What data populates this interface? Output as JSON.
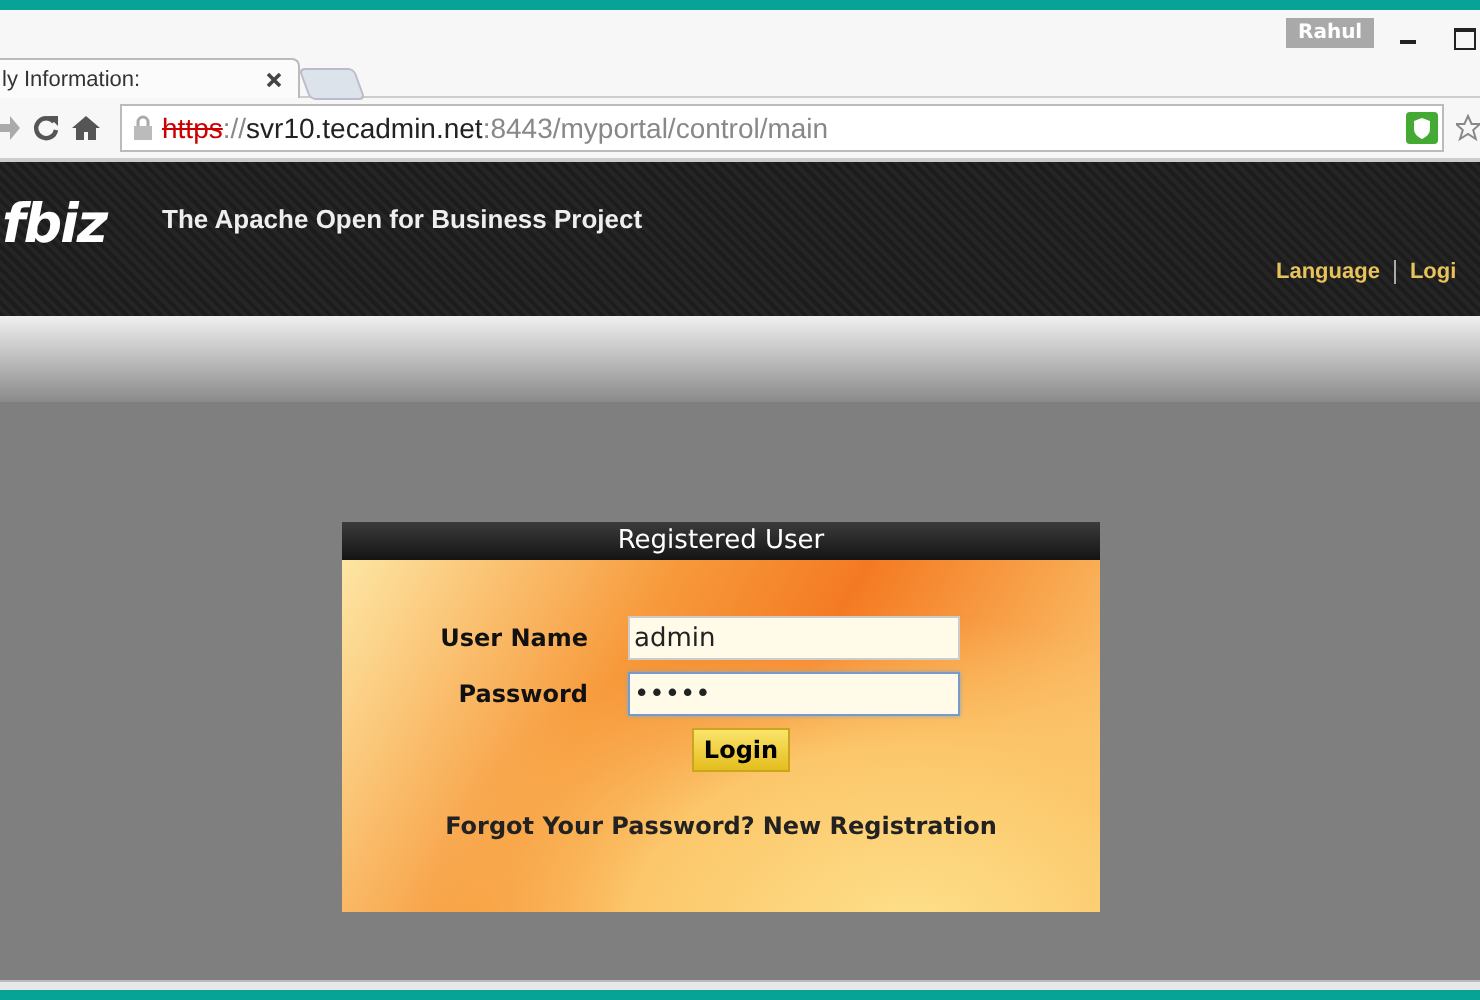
{
  "browser": {
    "user": "Rahul",
    "tab_title": "ly Information:",
    "url": {
      "scheme": "https",
      "separator": "://",
      "host": "svr10.tecadmin.net",
      "path": ":8443/myportal/control/main",
      "insecure": true
    }
  },
  "header": {
    "logo": "fbiz",
    "tagline": "The Apache Open for Business Project",
    "nav": [
      "Language",
      "Logi"
    ]
  },
  "login": {
    "title": "Registered User",
    "fields": [
      {
        "label": "User Name",
        "value": "admin",
        "focused": false
      },
      {
        "label": "Password",
        "value": "•••••",
        "focused": true
      }
    ],
    "button": "Login",
    "links": [
      "Forgot Your Password?",
      "New Registration"
    ]
  }
}
